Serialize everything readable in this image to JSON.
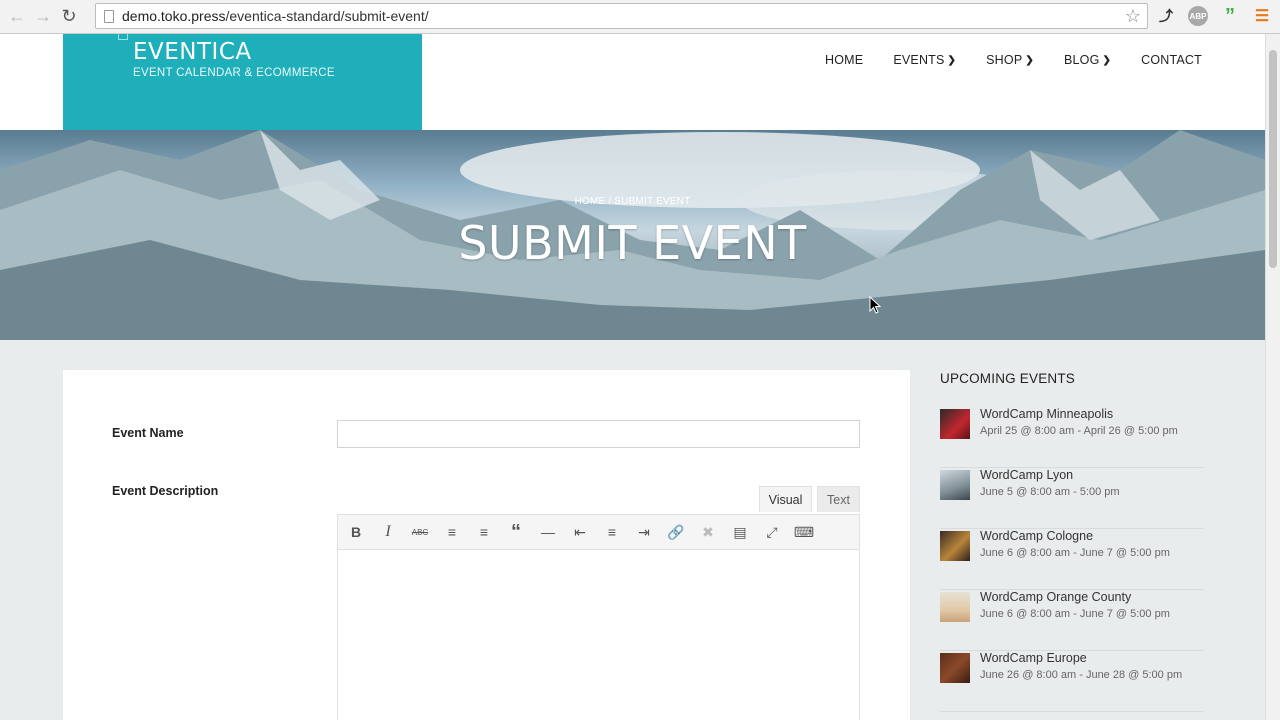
{
  "browser": {
    "url_domain": "demo.toko.press",
    "url_path": "/eventica-standard/submit-event/",
    "ext_abp": "ABP"
  },
  "site": {
    "logo_title": "EVENTICA",
    "logo_subtitle": "EVENT CALENDAR & ECOMMERCE",
    "menu": [
      {
        "label": "HOME",
        "dropdown": false
      },
      {
        "label": "EVENTS",
        "dropdown": true
      },
      {
        "label": "SHOP",
        "dropdown": true
      },
      {
        "label": "BLOG",
        "dropdown": true
      },
      {
        "label": "CONTACT",
        "dropdown": false
      }
    ],
    "accent_color": "#1eafbb"
  },
  "hero": {
    "breadcrumb": "HOME / SUBMIT EVENT",
    "title": "SUBMIT EVENT"
  },
  "form": {
    "event_name_label": "Event Name",
    "event_name_value": "",
    "event_description_label": "Event Description",
    "tab_visual": "Visual",
    "tab_text": "Text",
    "toolbar_icons": [
      "bold-icon",
      "italic-icon",
      "strikethrough-icon",
      "bullet-list-icon",
      "numbered-list-icon",
      "blockquote-icon",
      "horizontal-line-icon",
      "align-left-icon",
      "align-center-icon",
      "align-right-icon",
      "link-icon",
      "unlink-icon",
      "read-more-icon",
      "fullscreen-icon",
      "toolbar-toggle-icon"
    ]
  },
  "sidebar": {
    "title": "UPCOMING EVENTS",
    "events": [
      {
        "title": "WordCamp Minneapolis",
        "date": "April 25 @ 8:00 am - April 26 @ 5:00 pm"
      },
      {
        "title": "WordCamp Lyon",
        "date": "June 5 @ 8:00 am - 5:00 pm"
      },
      {
        "title": "WordCamp Cologne",
        "date": "June 6 @ 8:00 am - June 7 @ 5:00 pm"
      },
      {
        "title": "WordCamp Orange County",
        "date": "June 6 @ 8:00 am - June 7 @ 5:00 pm"
      },
      {
        "title": "WordCamp Europe",
        "date": "June 26 @ 8:00 am - June 28 @ 5:00 pm"
      }
    ]
  }
}
